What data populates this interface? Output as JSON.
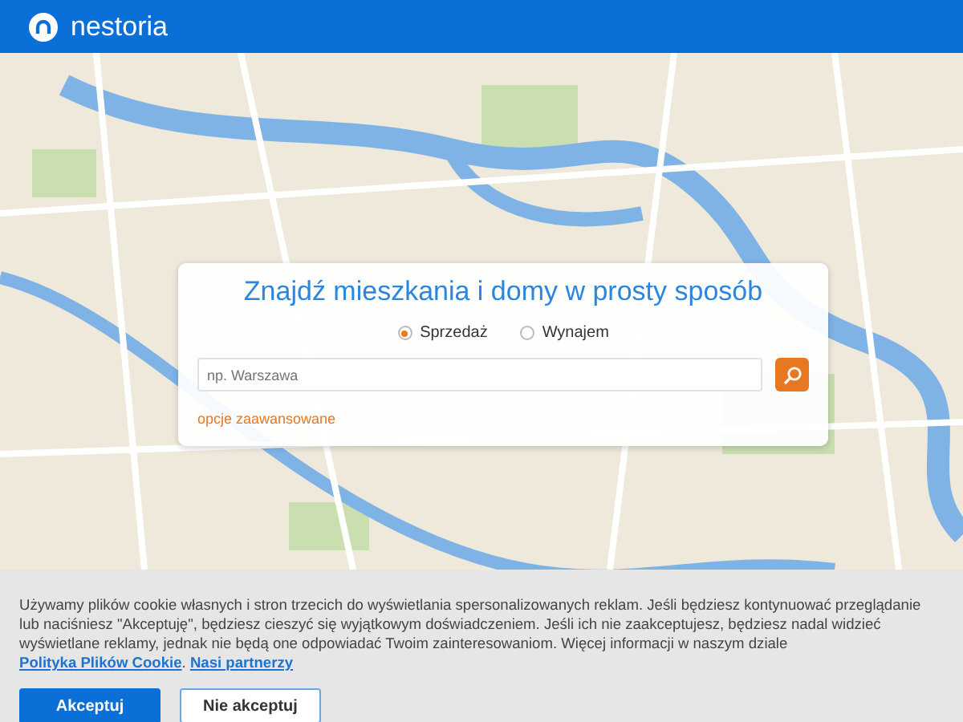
{
  "header": {
    "logo_text": "nestoria"
  },
  "search_card": {
    "title": "Znajdź mieszkania i domy w prosty sposób",
    "options": [
      {
        "label": "Sprzedaż",
        "selected": true
      },
      {
        "label": "Wynajem",
        "selected": false
      }
    ],
    "search": {
      "placeholder": "np. Warszawa"
    },
    "advanced_link": "opcje zaawansowane"
  },
  "cookie_bar": {
    "message": "Używamy plików cookie własnych i stron trzecich do wyświetlania spersonalizowanych reklam. Jeśli będziesz kontynuować przeglądanie lub naciśniesz \"Akceptuję\", będziesz cieszyć się wyjątkowym doświadczeniem. Jeśli ich nie zaakceptujesz, będziesz nadal widzieć wyświetlane reklamy, jednak nie będą one odpowiadać Twoim zainteresowaniom. Więcej informacji w naszym dziale",
    "links": [
      {
        "label": "Polityka Plików Cookie"
      },
      {
        "label": "Nasi partnerzy"
      }
    ],
    "link_separator": ".",
    "buttons": [
      {
        "label": "Akceptuj",
        "kind": "primary"
      },
      {
        "label": "Nie akceptuj",
        "kind": "outline"
      }
    ]
  }
}
